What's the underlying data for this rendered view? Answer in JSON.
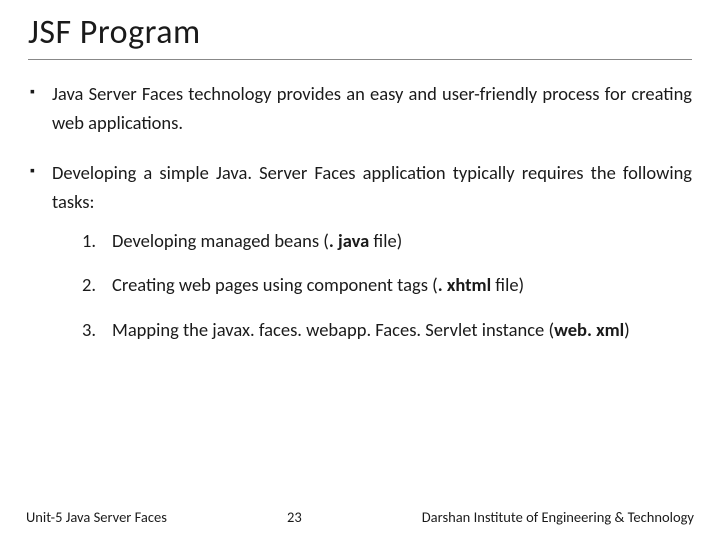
{
  "title": "JSF Program",
  "bullets": [
    "Java Server Faces technology provides an easy and user-friendly process for creating web applications.",
    "Developing a simple Java. Server Faces application typically requires the following tasks:"
  ],
  "tasks": [
    {
      "n": "1.",
      "pre": "Developing managed beans (",
      "bold": ". java",
      "post": " file)"
    },
    {
      "n": "2.",
      "pre": "Creating web pages using component tags (",
      "bold": ". xhtml",
      "post": " file)"
    },
    {
      "n": "3.",
      "pre": "Mapping the javax. faces. webapp. Faces. Servlet instance (",
      "bold": "web. xml",
      "post": ")"
    }
  ],
  "footer": {
    "left": "Unit-5 Java Server Faces",
    "center": "23",
    "right": "Darshan Institute of Engineering & Technology"
  }
}
